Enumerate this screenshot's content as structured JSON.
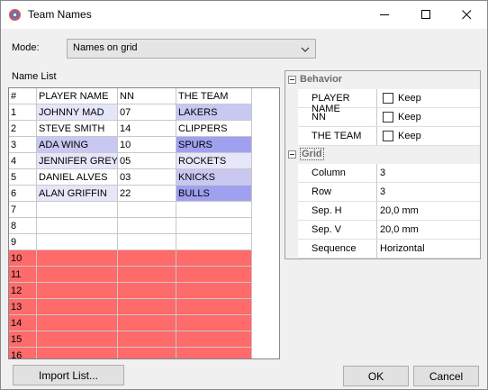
{
  "window": {
    "title": "Team Names",
    "minimize_icon": "minimize-icon",
    "maximize_icon": "maximize-icon",
    "close_icon": "close-icon"
  },
  "mode": {
    "label": "Mode:",
    "value": "Names on grid"
  },
  "name_list": {
    "label": "Name List",
    "headers": [
      "#",
      "PLAYER NAME",
      "NN",
      "THE TEAM"
    ],
    "rows": [
      [
        "1",
        "JOHNNY MAD",
        "07",
        "LAKERS"
      ],
      [
        "2",
        "STEVE SMITH",
        "14",
        "CLIPPERS"
      ],
      [
        "3",
        "ADA WING",
        "10",
        "SPURS"
      ],
      [
        "4",
        "JENNIFER GREY",
        "05",
        "ROCKETS"
      ],
      [
        "5",
        "DANIEL ALVES",
        "03",
        "KNICKS"
      ],
      [
        "6",
        "ALAN GRIFFIN",
        "22",
        "BULLS"
      ],
      [
        "7",
        "",
        "",
        ""
      ],
      [
        "8",
        "",
        "",
        ""
      ],
      [
        "9",
        "",
        "",
        ""
      ],
      [
        "10",
        "",
        "",
        ""
      ],
      [
        "11",
        "",
        "",
        ""
      ],
      [
        "12",
        "",
        "",
        ""
      ],
      [
        "13",
        "",
        "",
        ""
      ],
      [
        "14",
        "",
        "",
        ""
      ],
      [
        "15",
        "",
        "",
        ""
      ],
      [
        "16",
        "",
        "",
        ""
      ]
    ],
    "colors": {
      "light": "#e6e6fa",
      "medium": "#c8c8f2",
      "strong": "#a0a0f0",
      "overflow": "#ff6a6a"
    }
  },
  "properties": {
    "behavior": {
      "label": "Behavior",
      "items": [
        {
          "name": "PLAYER NAME",
          "check_label": "Keep"
        },
        {
          "name": "NN",
          "check_label": "Keep"
        },
        {
          "name": "THE TEAM",
          "check_label": "Keep"
        }
      ]
    },
    "grid": {
      "label": "Grid",
      "items": [
        {
          "name": "Column",
          "value": "3"
        },
        {
          "name": "Row",
          "value": "3"
        },
        {
          "name": "Sep. H",
          "value": "20,0 mm"
        },
        {
          "name": "Sep. V",
          "value": "20,0 mm"
        },
        {
          "name": "Sequence",
          "value": "Horizontal"
        }
      ]
    }
  },
  "buttons": {
    "import": "Import List...",
    "ok": "OK",
    "cancel": "Cancel"
  }
}
